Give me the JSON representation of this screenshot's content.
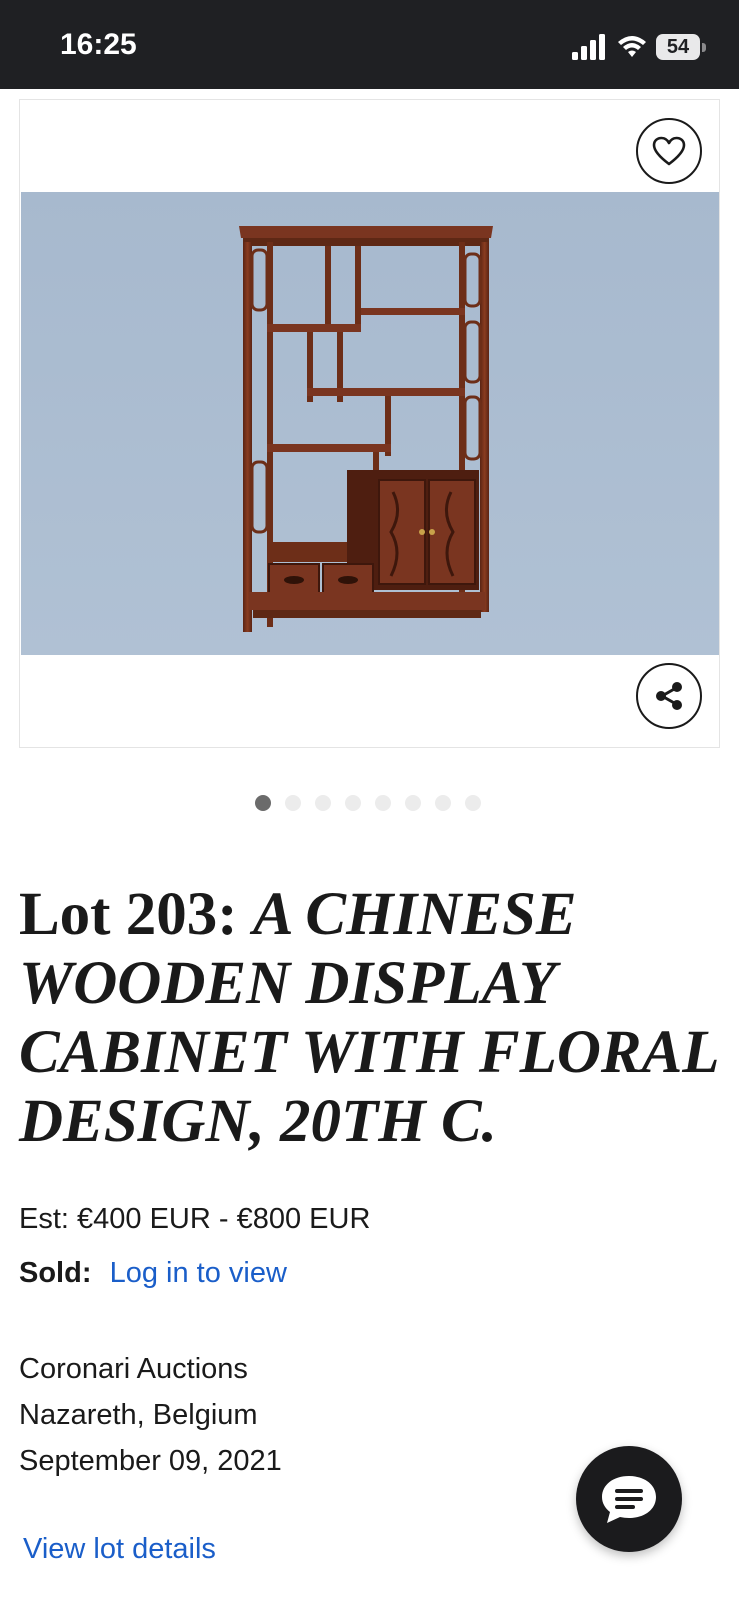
{
  "status_bar": {
    "time": "16:25",
    "battery": "54",
    "icons": [
      "signal-icon",
      "wifi-icon",
      "battery-icon"
    ]
  },
  "gallery": {
    "image_description_icon": "cabinet-photo",
    "dots_total": 8,
    "active_dot": 1,
    "favorite_icon": "heart-icon",
    "share_icon": "share-icon"
  },
  "lot": {
    "lot_prefix": "Lot 203:",
    "name": "A CHINESE WOODEN DISPLAY CABINET WITH FLORAL DESIGN, 20TH C.",
    "estimate": "Est: €400 EUR - €800 EUR",
    "sold_label": "Sold:",
    "sold_value": "Log in to view"
  },
  "auction": {
    "house": "Coronari Auctions",
    "location": "Nazareth, Belgium",
    "date": "September 09, 2021"
  },
  "actions": {
    "view_details": "View lot details",
    "chat_icon": "chat-icon"
  },
  "colors": {
    "status_bar_bg": "#1f2023",
    "photo_bg": "#a9bbd0",
    "link": "#1a5ec9",
    "wood": "#6b2f1a"
  }
}
